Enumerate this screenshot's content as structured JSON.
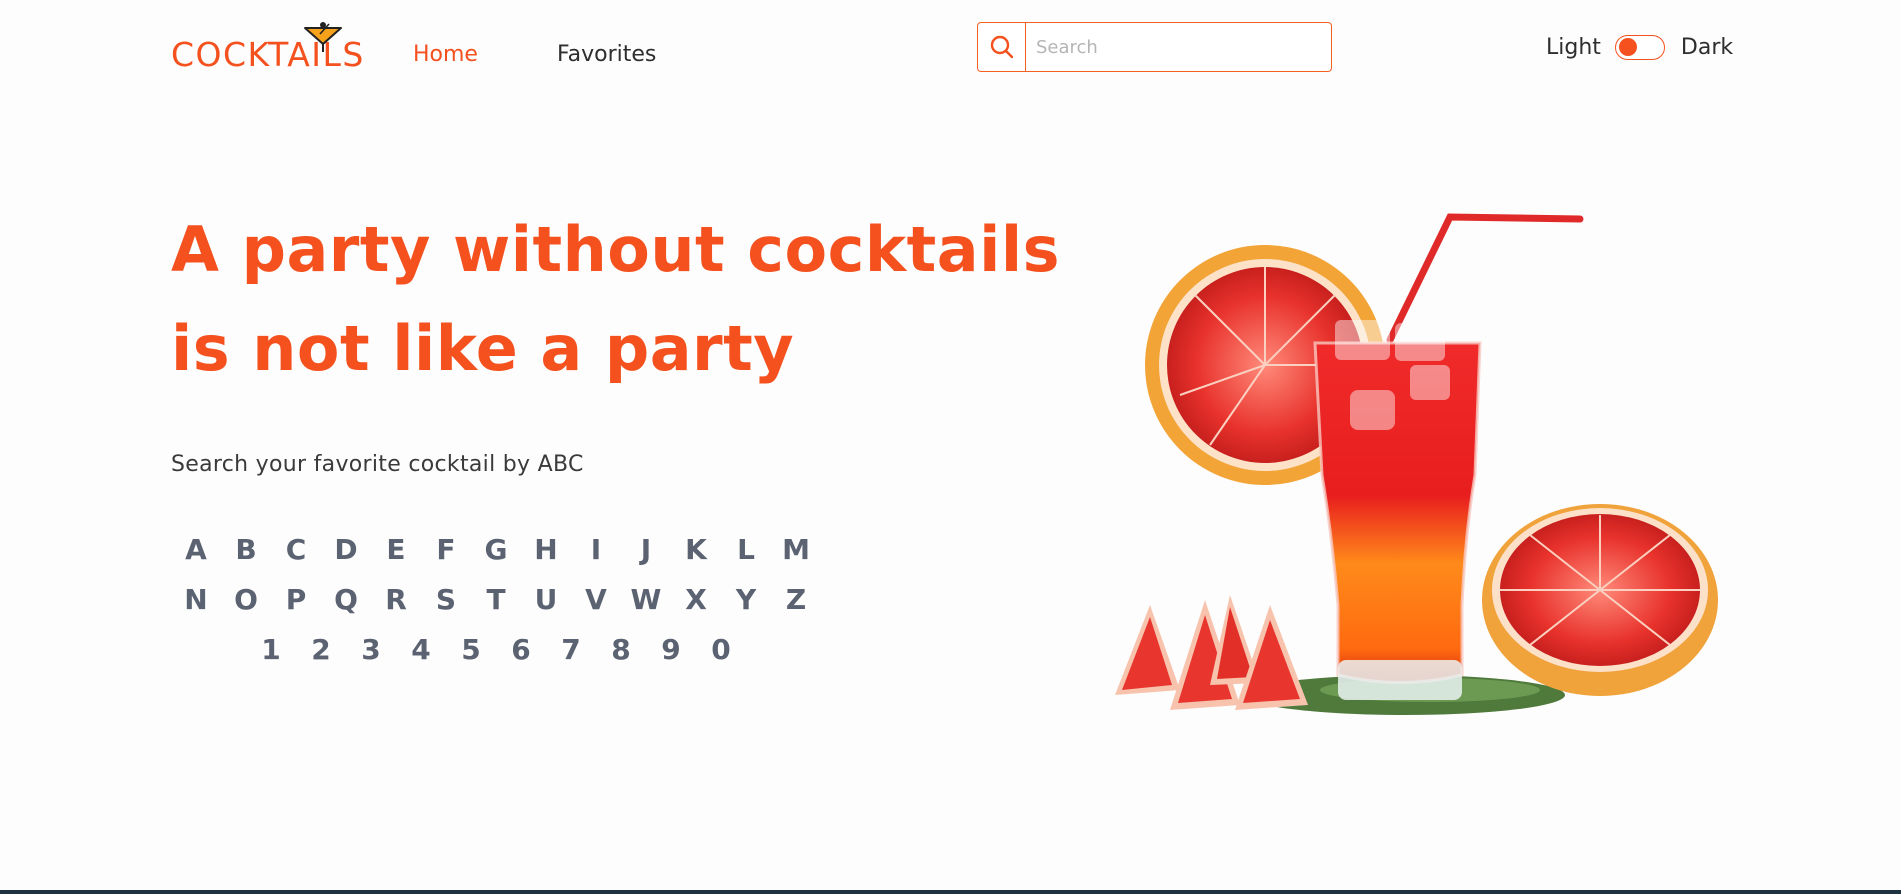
{
  "header": {
    "logo_text": "COCKTAILS",
    "nav": [
      {
        "label": "Home",
        "active": true
      },
      {
        "label": "Favorites",
        "active": false
      }
    ],
    "search": {
      "placeholder": "Search",
      "value": "",
      "icon": "search-icon"
    },
    "theme": {
      "light_label": "Light",
      "dark_label": "Dark",
      "state": "light"
    }
  },
  "hero": {
    "title_line1": "A party without cocktails",
    "title_line2": "is not like a party",
    "subtitle": "Search your favorite cocktail by ABC"
  },
  "abc": {
    "row1": [
      "A",
      "B",
      "C",
      "D",
      "E",
      "F",
      "G",
      "H",
      "I",
      "J",
      "K",
      "L",
      "M"
    ],
    "row2": [
      "N",
      "O",
      "P",
      "Q",
      "R",
      "S",
      "T",
      "U",
      "V",
      "W",
      "X",
      "Y",
      "Z"
    ],
    "row3": [
      "1",
      "2",
      "3",
      "4",
      "5",
      "6",
      "7",
      "8",
      "9",
      "0"
    ]
  },
  "colors": {
    "accent": "#f4511e",
    "letters": "#5b6271",
    "footer": "#1f3240"
  }
}
